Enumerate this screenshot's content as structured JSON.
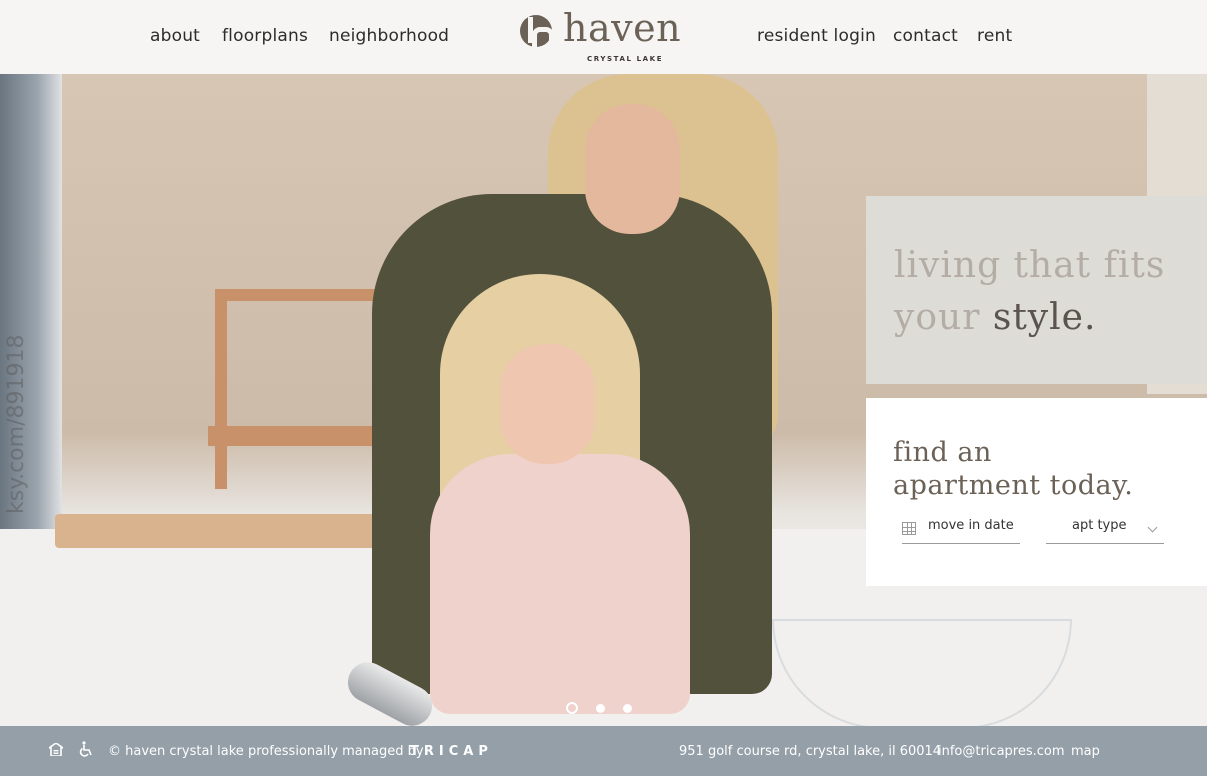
{
  "nav": {
    "left": [
      "about",
      "floorplans",
      "neighborhood"
    ],
    "right": [
      "resident login",
      "contact",
      "rent"
    ]
  },
  "logo": {
    "name": "haven",
    "subtitle": "CRYSTAL LAKE"
  },
  "hero": {
    "watermark": "ksy.com/891918",
    "tagline_light_1": "living that fits",
    "tagline_light_2": "your",
    "tagline_dark": "style.",
    "slides": {
      "count": 3,
      "active": 1
    }
  },
  "finder": {
    "title_1": "find an",
    "title_2": "apartment today.",
    "date_placeholder": "move in date",
    "apt_type_label": "apt type"
  },
  "footer": {
    "copyright": "© haven crystal lake professionally managed by",
    "manager": "TRICAP",
    "address": "951 golf course rd, crystal lake, il 60014",
    "email": "info@tricapres.com",
    "map": "map"
  },
  "colors": {
    "header_bg": "#f6f5f3",
    "brand": "#6b6157",
    "footer_bg": "#949fa8",
    "tagline_panel": "#dedcd7"
  }
}
